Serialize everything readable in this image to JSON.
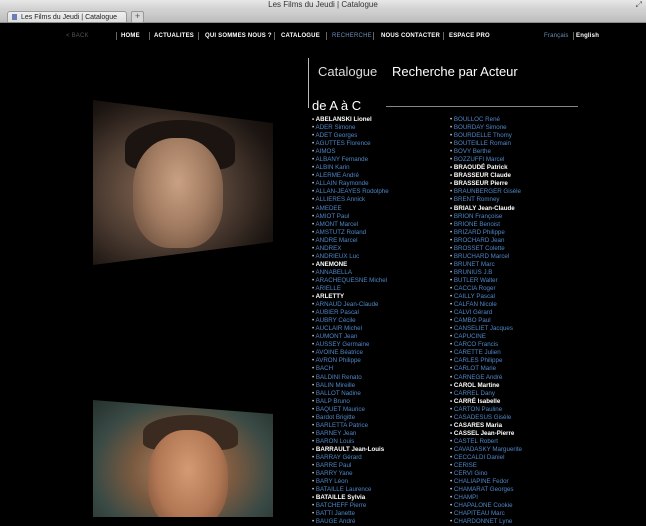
{
  "window": {
    "title": "Les Films du Jeudi | Catalogue",
    "tab_label": "Les Films du Jeudi | Catalogue",
    "new_tab": "+"
  },
  "nav": {
    "back": "< BACK",
    "items": [
      "HOME",
      "ACTUALITES",
      "QUI SOMMES NOUS ?",
      "CATALOGUE",
      "RECHERCHE",
      "NOUS CONTACTER",
      "ESPACE PRO"
    ],
    "lang_fr": "Français",
    "lang_en": "English"
  },
  "catalogue": {
    "title": "Catalogue",
    "subtitle": "Recherche par Acteur",
    "range": "de A à C"
  },
  "colors": {
    "link": "#4f86c6",
    "highlight": "#ffffff",
    "background": "#000000"
  },
  "actors_col1": [
    {
      "name": "ABELANSKI Lionel",
      "hl": true
    },
    {
      "name": "ADER Simone"
    },
    {
      "name": "ADET Georges"
    },
    {
      "name": "AGUTTES Florence"
    },
    {
      "name": "AIMOS"
    },
    {
      "name": "ALBANY Fernande"
    },
    {
      "name": "ALBIN Karin"
    },
    {
      "name": "ALERME André"
    },
    {
      "name": "ALLAIN Raymonde"
    },
    {
      "name": "ALLAN-JEAYES Rodolphe"
    },
    {
      "name": "ALLIERES Annick"
    },
    {
      "name": "AMEDEE"
    },
    {
      "name": "AMIOT Paul"
    },
    {
      "name": "AMONT Marcel"
    },
    {
      "name": "AMSTUTZ Roland"
    },
    {
      "name": "ANDRE Marcel"
    },
    {
      "name": "ANDREX"
    },
    {
      "name": "ANDRIEUX Luc"
    },
    {
      "name": "ANEMONE",
      "hl": true
    },
    {
      "name": "ANNABELLA"
    },
    {
      "name": "ARACHEQUESNE Michel"
    },
    {
      "name": "ARIELLE"
    },
    {
      "name": "ARLETTY",
      "hl": true
    },
    {
      "name": "ARNAUD Jean-Claude"
    },
    {
      "name": "AUBIER Pascal"
    },
    {
      "name": "AUBRY Cécile"
    },
    {
      "name": "AUCLAIR Michel"
    },
    {
      "name": "AUMONT Jean"
    },
    {
      "name": "AUSSEY Germaine"
    },
    {
      "name": "AVOINE Béatrice"
    },
    {
      "name": "AVRON Philippe"
    },
    {
      "name": "BACH"
    },
    {
      "name": "BALDINI Renato"
    },
    {
      "name": "BALIN Mireille"
    },
    {
      "name": "BALLOT Nadine"
    },
    {
      "name": "BALP Bruno"
    },
    {
      "name": "BAQUET Maurice"
    },
    {
      "name": "Bardot Brigitte"
    },
    {
      "name": "BARLETTA Patrice"
    },
    {
      "name": "BARNEY Jean"
    },
    {
      "name": "BARON Louis"
    },
    {
      "name": "BARRAULT Jean-Louis",
      "hl": true
    },
    {
      "name": "BARRAY Gérard"
    },
    {
      "name": "BARRE Paul"
    },
    {
      "name": "BARRY Yane"
    },
    {
      "name": "BARY Léon"
    },
    {
      "name": "BATAILLE Laurence"
    },
    {
      "name": "BATAILLE Sylvia",
      "hl": true
    },
    {
      "name": "BATCHEFF Pierre"
    },
    {
      "name": "BATTI Janette"
    },
    {
      "name": "BAUGE André"
    }
  ],
  "actors_col2": [
    {
      "name": "BOULLOC René"
    },
    {
      "name": "BOURDAY Simone"
    },
    {
      "name": "BOURDELLE Thomy"
    },
    {
      "name": "BOUTEILLE Romain"
    },
    {
      "name": "BOVY Berthe"
    },
    {
      "name": "BOZZUFFI Marcel"
    },
    {
      "name": "BRAOUDÉ Patrick",
      "hl": true
    },
    {
      "name": "BRASSEUR Claude",
      "hl": true
    },
    {
      "name": "BRASSEUR Pierre",
      "hl": true
    },
    {
      "name": "BRAUNBERGER Gisèle"
    },
    {
      "name": "BRENT Romney"
    },
    {
      "name": "BRIALY Jean-Claude",
      "hl": true
    },
    {
      "name": "BRION Françoise"
    },
    {
      "name": "BRIONE Benoist"
    },
    {
      "name": "BRIZARD Philippe"
    },
    {
      "name": "BROCHARD Jean"
    },
    {
      "name": "BROSSET Colette"
    },
    {
      "name": "BRUCHARD Marcel"
    },
    {
      "name": "BRUNET Marc"
    },
    {
      "name": "BRUNIUS J.B"
    },
    {
      "name": "BUTLER Walter"
    },
    {
      "name": "CACCIA Roger"
    },
    {
      "name": "CAILLY Pascal"
    },
    {
      "name": "CALFAN Nicole"
    },
    {
      "name": "CALVI Gérard"
    },
    {
      "name": "CAMBO Paul"
    },
    {
      "name": "CANSELIET Jacques"
    },
    {
      "name": "CAPUCINE"
    },
    {
      "name": "CARCO Francis"
    },
    {
      "name": "CARETTE Julien"
    },
    {
      "name": "CARLES Philippe"
    },
    {
      "name": "CARLOT Marie"
    },
    {
      "name": "CARNEGE André"
    },
    {
      "name": "CAROL Martine",
      "hl": true
    },
    {
      "name": "CARREL Dany"
    },
    {
      "name": "CARRÉ Isabelle",
      "hl": true
    },
    {
      "name": "CARTON Pauline"
    },
    {
      "name": "CASADESUS Gisèle"
    },
    {
      "name": "CASARES Maria",
      "hl": true
    },
    {
      "name": "CASSEL Jean-Pierre",
      "hl": true
    },
    {
      "name": "CASTEL Robert"
    },
    {
      "name": "CAVADASKY Marguerite"
    },
    {
      "name": "CECCALDI Daniel"
    },
    {
      "name": "CERISE"
    },
    {
      "name": "CERVI Gino"
    },
    {
      "name": "CHALIAPINE Fedor"
    },
    {
      "name": "CHAMARAT Georges"
    },
    {
      "name": "CHAMPI"
    },
    {
      "name": "CHAPALONE Cookie"
    },
    {
      "name": "CHAPITEAU Marc"
    },
    {
      "name": "CHARDONNET Lyne"
    }
  ]
}
